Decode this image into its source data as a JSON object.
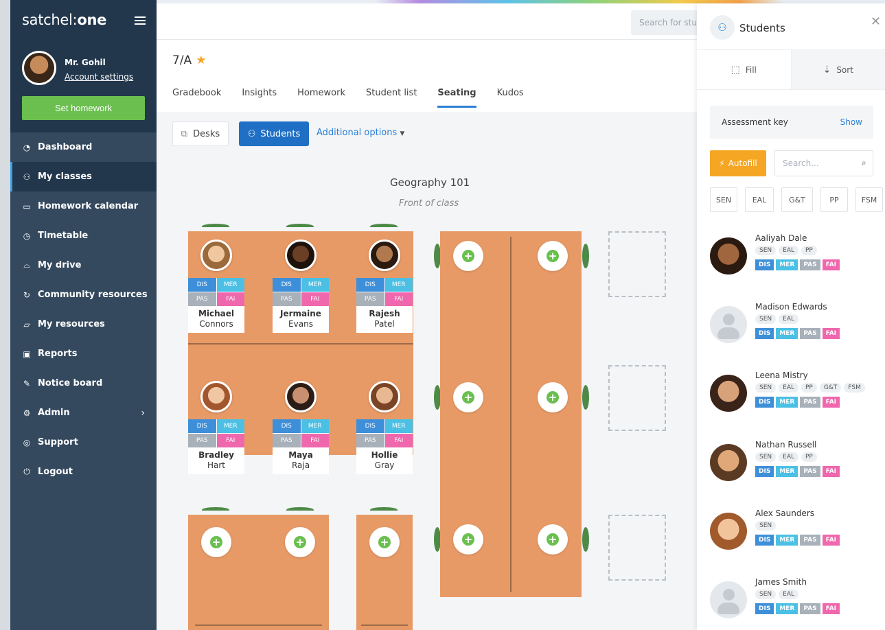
{
  "sidebar": {
    "logo_prefix": "satchel:",
    "logo_suffix": "one",
    "user_name": "Mr. Gohil",
    "account_settings": "Account settings",
    "set_homework": "Set homework",
    "nav": [
      {
        "label": "Dashboard",
        "icon": "dashboard-icon"
      },
      {
        "label": "My classes",
        "icon": "people-icon"
      },
      {
        "label": "Homework calendar",
        "icon": "calendar-icon"
      },
      {
        "label": "Timetable",
        "icon": "clock-icon"
      },
      {
        "label": "My drive",
        "icon": "drive-icon"
      },
      {
        "label": "Community resources",
        "icon": "sync-icon"
      },
      {
        "label": "My resources",
        "icon": "folder-icon"
      },
      {
        "label": "Reports",
        "icon": "report-icon"
      },
      {
        "label": "Notice board",
        "icon": "pin-icon"
      },
      {
        "label": "Admin",
        "icon": "gear-icon"
      },
      {
        "label": "Support",
        "icon": "lifebuoy-icon"
      },
      {
        "label": "Logout",
        "icon": "power-icon"
      }
    ]
  },
  "header": {
    "search_placeholder": "Search for stu",
    "class_title": "7/A",
    "tabs": [
      "Gradebook",
      "Insights",
      "Homework",
      "Student list",
      "Seating",
      "Kudos"
    ]
  },
  "toolbar": {
    "desks": "Desks",
    "students": "Students",
    "additional_options": "Additional options"
  },
  "room": {
    "title": "Geography 101",
    "subtitle": "Front of class"
  },
  "seats": [
    {
      "first": "Michael",
      "last": "Connors"
    },
    {
      "first": "Jermaine",
      "last": "Evans"
    },
    {
      "first": "Rajesh",
      "last": "Patel"
    },
    {
      "first": "Bradley",
      "last": "Hart"
    },
    {
      "first": "Maya",
      "last": "Raja"
    },
    {
      "first": "Hollie",
      "last": "Gray"
    }
  ],
  "seat_tags": [
    "DIS",
    "MER",
    "PAS",
    "FAI"
  ],
  "panel": {
    "title": "Students",
    "fill": "Fill",
    "sort": "Sort",
    "assessment_key": "Assessment key",
    "show": "Show",
    "autofill": "Autofill",
    "search_placeholder": "Search...",
    "filters": [
      "SEN",
      "EAL",
      "G&T",
      "PP",
      "FSM"
    ],
    "students": [
      {
        "name": "Aaliyah Dale",
        "flags": [
          "SEN",
          "EAL",
          "PP"
        ]
      },
      {
        "name": "Madison Edwards",
        "flags": [
          "SEN",
          "EAL"
        ]
      },
      {
        "name": "Leena Mistry",
        "flags": [
          "SEN",
          "EAL",
          "PP",
          "G&T",
          "FSM"
        ]
      },
      {
        "name": "Nathan Russell",
        "flags": [
          "SEN",
          "EAL",
          "PP"
        ]
      },
      {
        "name": "Alex Saunders",
        "flags": [
          "SEN"
        ]
      },
      {
        "name": "James Smith",
        "flags": [
          "SEN",
          "EAL"
        ]
      }
    ]
  },
  "colors": {
    "sidebar": "#34495e",
    "accent_blue": "#1f6fc4",
    "green": "#6bbf4f",
    "orange": "#f5a623",
    "table": "#e89a66",
    "tag_dis": "#3e8fd9",
    "tag_mer": "#4bc0e4",
    "tag_pas": "#a8b0b9",
    "tag_fai": "#ef67ac"
  }
}
